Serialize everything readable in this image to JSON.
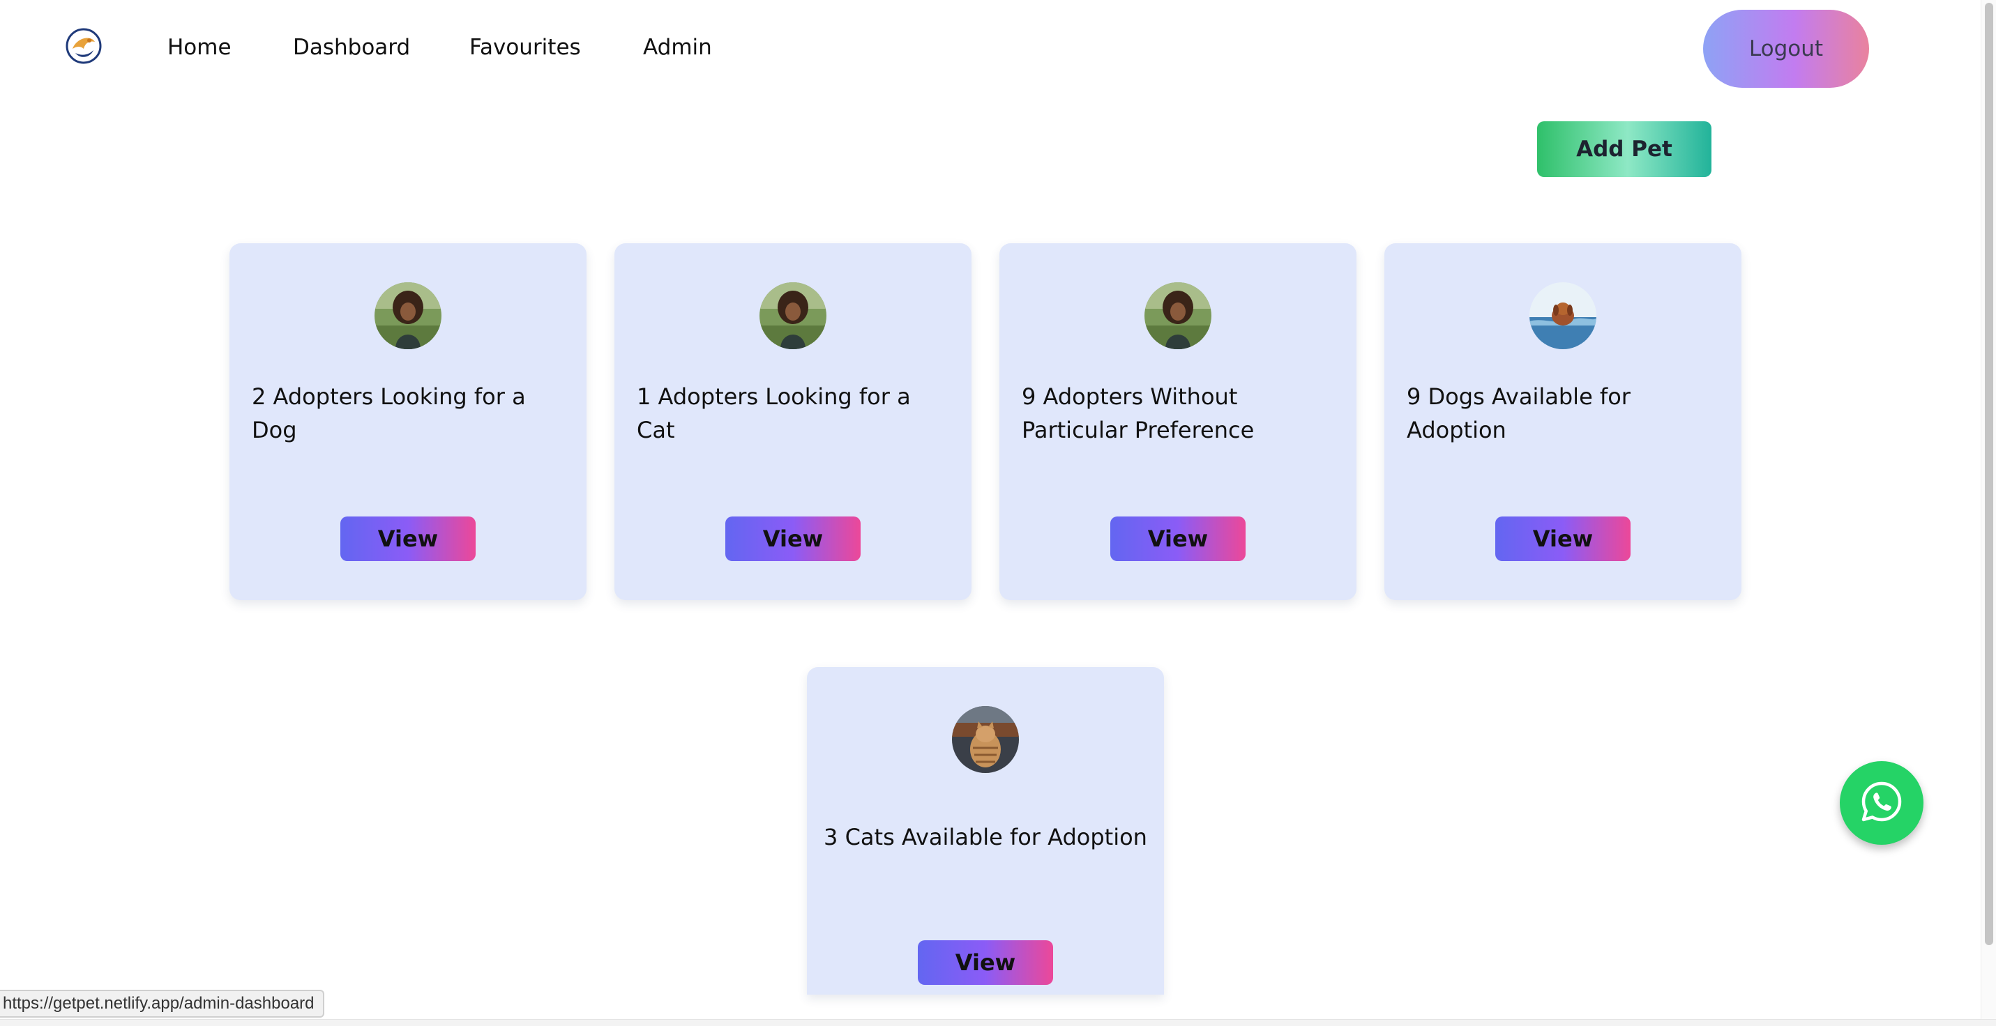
{
  "nav": {
    "links": [
      "Home",
      "Dashboard",
      "Favourites",
      "Admin"
    ],
    "logout_label": "Logout"
  },
  "actions": {
    "add_pet_label": "Add Pet"
  },
  "cards": [
    {
      "title": "2 Adopters Looking for a Dog",
      "button": "View",
      "image": "woman-portrait"
    },
    {
      "title": "1 Adopters Looking for a Cat",
      "button": "View",
      "image": "woman-portrait"
    },
    {
      "title": "9 Adopters Without Particular Preference",
      "button": "View",
      "image": "woman-portrait"
    },
    {
      "title": "9 Dogs Available for Adoption",
      "button": "View",
      "image": "dog-in-water"
    },
    {
      "title": "3 Cats Available for Adoption",
      "button": "View",
      "image": "tabby-cat"
    }
  ],
  "floating": {
    "icon": "whatsapp-icon",
    "color": "#25d366"
  },
  "status_bar": {
    "url": "https://getpet.netlify.app/admin-dashboard"
  },
  "colors": {
    "card_bg": "#e0e7fb",
    "view_gradient": [
      "#6366f1",
      "#ec4899"
    ],
    "add_pet_gradient": [
      "#2fc06a",
      "#22b39a"
    ],
    "logout_gradient": [
      "#8ea2f5",
      "#e9829e"
    ]
  }
}
